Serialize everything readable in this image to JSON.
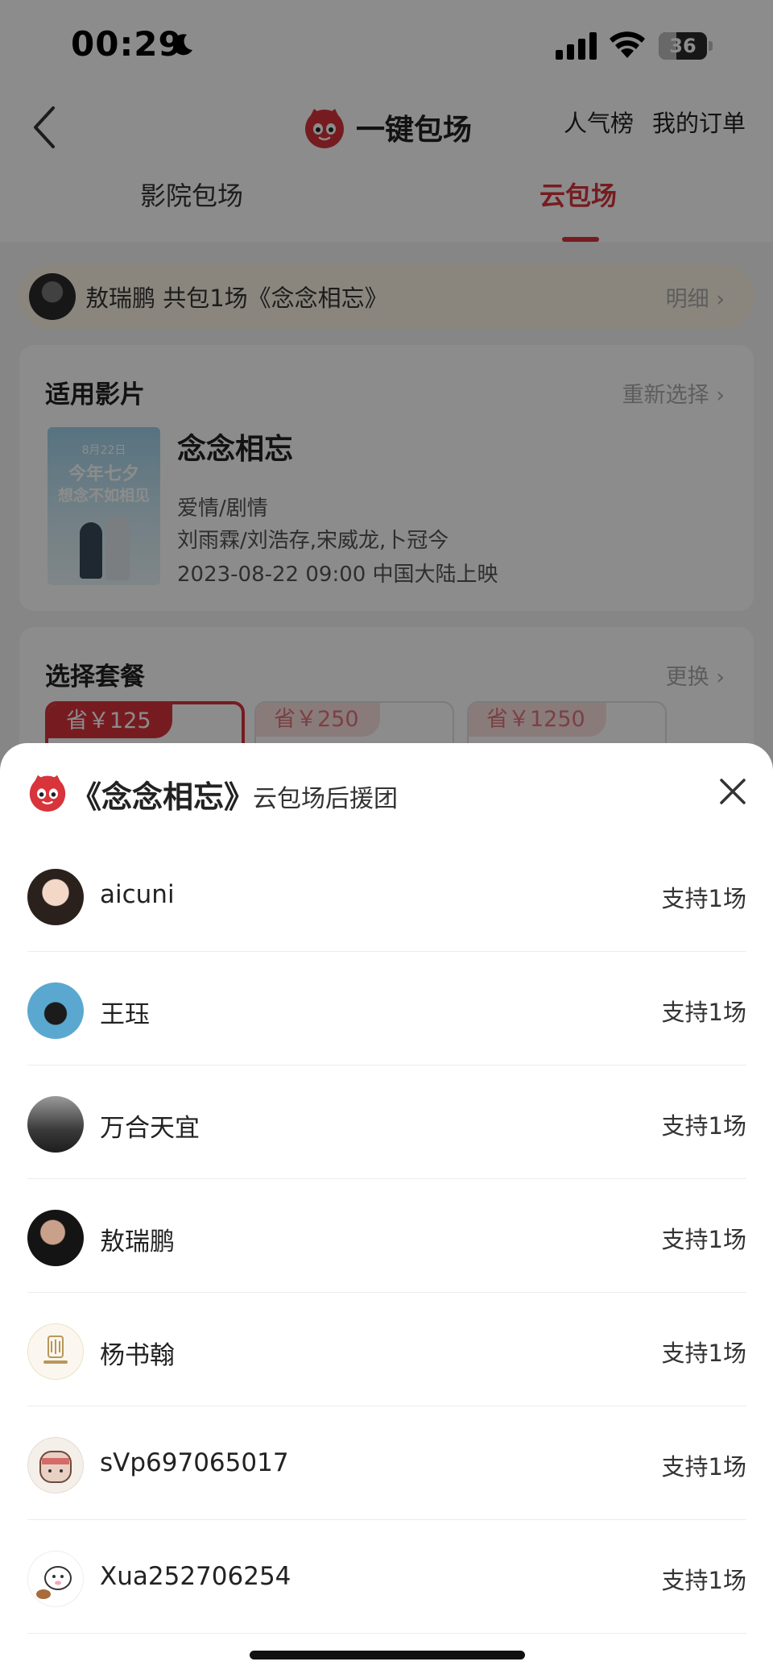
{
  "status_bar": {
    "time": "00:29",
    "battery": "36",
    "battery_level": 0.36,
    "icons": [
      "moon-icon",
      "cellular-signal-icon",
      "wifi-icon",
      "battery-icon"
    ]
  },
  "header": {
    "back_icon": "chevron-left-icon",
    "logo_icon": "cat-logo-icon",
    "title": "一键包场",
    "links": [
      "人气榜",
      "我的订单"
    ],
    "tabs": [
      {
        "label": "影院包场",
        "active": false
      },
      {
        "label": "云包场",
        "active": true
      }
    ]
  },
  "notice": {
    "text": "敖瑞鹏 共包1场《念念相忘》",
    "detail": "明细"
  },
  "film_card": {
    "title": "适用影片",
    "action": "重新选择",
    "poster": {
      "date": "8月22日",
      "line1": "今年七夕",
      "line2": "想念不如相见"
    },
    "film": {
      "name": "念念相忘",
      "genre": "爱情/剧情",
      "cast": "刘雨霖/刘浩存,宋威龙,卜冠今",
      "release": "2023-08-22 09:00 中国大陆上映"
    }
  },
  "combo_card": {
    "title": "选择套餐",
    "action": "更换",
    "options": [
      {
        "badge": "省￥125",
        "selected": true
      },
      {
        "badge": "省￥250",
        "selected": false
      },
      {
        "badge": "省￥1250",
        "selected": false
      }
    ]
  },
  "sheet": {
    "logo_icon": "cat-logo-icon",
    "title": "《念念相忘》",
    "subtitle": "云包场后援团",
    "close_icon": "close-icon",
    "supporters": [
      {
        "name": "aicuni",
        "count": "支持1场"
      },
      {
        "name": "王珏",
        "count": "支持1场"
      },
      {
        "name": "万合天宜",
        "count": "支持1场"
      },
      {
        "name": "敖瑞鹏",
        "count": "支持1场"
      },
      {
        "name": "杨书翰",
        "count": "支持1场"
      },
      {
        "name": "sVp697065017",
        "count": "支持1场"
      },
      {
        "name": "Xua252706254",
        "count": "支持1场"
      }
    ]
  },
  "colors": {
    "accent": "#d8343c",
    "notice_bg": "#fbf4e5",
    "overlay": "rgba(0,0,0,0.45)"
  }
}
